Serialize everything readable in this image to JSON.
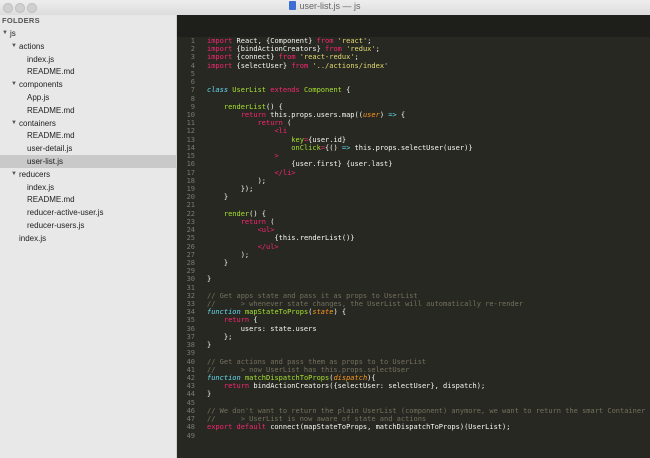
{
  "window": {
    "title": "user-list.js — js"
  },
  "sidebar": {
    "header": "FOLDERS",
    "items": [
      {
        "label": "js",
        "depth": 0,
        "type": "folder"
      },
      {
        "label": "actions",
        "depth": 1,
        "type": "folder"
      },
      {
        "label": "index.js",
        "depth": 2,
        "type": "file"
      },
      {
        "label": "README.md",
        "depth": 2,
        "type": "file"
      },
      {
        "label": "components",
        "depth": 1,
        "type": "folder"
      },
      {
        "label": "App.js",
        "depth": 2,
        "type": "file"
      },
      {
        "label": "README.md",
        "depth": 2,
        "type": "file"
      },
      {
        "label": "containers",
        "depth": 1,
        "type": "folder"
      },
      {
        "label": "README.md",
        "depth": 2,
        "type": "file"
      },
      {
        "label": "user-detail.js",
        "depth": 2,
        "type": "file"
      },
      {
        "label": "user-list.js",
        "depth": 2,
        "type": "file",
        "selected": true
      },
      {
        "label": "reducers",
        "depth": 1,
        "type": "folder"
      },
      {
        "label": "index.js",
        "depth": 2,
        "type": "file"
      },
      {
        "label": "README.md",
        "depth": 2,
        "type": "file"
      },
      {
        "label": "reducer-active-user.js",
        "depth": 2,
        "type": "file"
      },
      {
        "label": "reducer-users.js",
        "depth": 2,
        "type": "file"
      },
      {
        "label": "index.js",
        "depth": 1,
        "type": "file"
      }
    ]
  },
  "editor": {
    "lines": [
      [
        [
          "k",
          "import "
        ],
        [
          "",
          "React, {Component} "
        ],
        [
          "k",
          "from "
        ],
        [
          "s",
          "'react'"
        ],
        [
          "",
          ";"
        ]
      ],
      [
        [
          "k",
          "import "
        ],
        [
          "",
          "{bindActionCreators} "
        ],
        [
          "k",
          "from "
        ],
        [
          "s",
          "'redux'"
        ],
        [
          "",
          ";"
        ]
      ],
      [
        [
          "k",
          "import "
        ],
        [
          "",
          "{connect} "
        ],
        [
          "k",
          "from "
        ],
        [
          "s",
          "'react-redux'"
        ],
        [
          "",
          ";"
        ]
      ],
      [
        [
          "k",
          "import "
        ],
        [
          "",
          "{selectUser} "
        ],
        [
          "k",
          "from "
        ],
        [
          "s",
          "'../actions/index'"
        ]
      ],
      [],
      [],
      [
        [
          "t",
          "class "
        ],
        [
          "f",
          "UserList "
        ],
        [
          "k",
          "extends "
        ],
        [
          "f",
          "Component "
        ],
        [
          "",
          "{"
        ]
      ],
      [],
      [
        [
          "",
          "    "
        ],
        [
          "f",
          "renderList"
        ],
        [
          "",
          "() {"
        ]
      ],
      [
        [
          "",
          "        "
        ],
        [
          "k",
          "return "
        ],
        [
          "",
          "this.props.users.map(("
        ],
        [
          "p",
          "user"
        ],
        [
          "",
          ") "
        ],
        [
          "t",
          "=>"
        ],
        [
          "",
          " {"
        ]
      ],
      [
        [
          "",
          "            "
        ],
        [
          "k",
          "return "
        ],
        [
          "",
          "("
        ]
      ],
      [
        [
          "",
          "                "
        ],
        [
          "k",
          "<"
        ],
        [
          "k",
          "li"
        ]
      ],
      [
        [
          "",
          "                    "
        ],
        [
          "a",
          "key"
        ],
        [
          "k",
          "="
        ],
        [
          "",
          "{user.id}"
        ]
      ],
      [
        [
          "",
          "                    "
        ],
        [
          "a",
          "onClick"
        ],
        [
          "k",
          "="
        ],
        [
          "",
          "{() "
        ],
        [
          "t",
          "=>"
        ],
        [
          "",
          " this.props.selectUser(user)}"
        ]
      ],
      [
        [
          "",
          "                "
        ],
        [
          "k",
          ">"
        ]
      ],
      [
        [
          "",
          "                    "
        ],
        [
          "",
          "{user.first} {user.last}"
        ]
      ],
      [
        [
          "",
          "                "
        ],
        [
          "k",
          "</li>"
        ]
      ],
      [
        [
          "",
          "            );"
        ]
      ],
      [
        [
          "",
          "        });"
        ]
      ],
      [
        [
          "",
          "    }"
        ]
      ],
      [],
      [
        [
          "",
          "    "
        ],
        [
          "f",
          "render"
        ],
        [
          "",
          "() {"
        ]
      ],
      [
        [
          "",
          "        "
        ],
        [
          "k",
          "return "
        ],
        [
          "",
          "("
        ]
      ],
      [
        [
          "",
          "            "
        ],
        [
          "k",
          "<ul>"
        ]
      ],
      [
        [
          "",
          "                "
        ],
        [
          "",
          "{this.renderList()}"
        ]
      ],
      [
        [
          "",
          "            "
        ],
        [
          "k",
          "</ul>"
        ]
      ],
      [
        [
          "",
          "        );"
        ]
      ],
      [
        [
          "",
          "    }"
        ]
      ],
      [],
      [
        [
          "",
          "}"
        ]
      ],
      [],
      [
        [
          "c",
          "// Get apps state and pass it as props to UserList"
        ]
      ],
      [
        [
          "c",
          "//      > whenever state changes, the UserList will automatically re-render"
        ]
      ],
      [
        [
          "t",
          "function "
        ],
        [
          "f",
          "mapStateToProps"
        ],
        [
          "",
          "("
        ],
        [
          "p",
          "state"
        ],
        [
          "",
          ") {"
        ]
      ],
      [
        [
          "",
          "    "
        ],
        [
          "k",
          "return "
        ],
        [
          "",
          "{"
        ]
      ],
      [
        [
          "",
          "        users: state.users"
        ]
      ],
      [
        [
          "",
          "    };"
        ]
      ],
      [
        [
          "",
          "}"
        ]
      ],
      [],
      [
        [
          "c",
          "// Get actions and pass them as props to to UserList"
        ]
      ],
      [
        [
          "c",
          "//      > now UserList has this.props.selectUser"
        ]
      ],
      [
        [
          "t",
          "function "
        ],
        [
          "f",
          "matchDispatchToProps"
        ],
        [
          "",
          "("
        ],
        [
          "p",
          "dispatch"
        ],
        [
          "",
          "){"
        ]
      ],
      [
        [
          "",
          "    "
        ],
        [
          "k",
          "return "
        ],
        [
          "",
          "bindActionCreators({selectUser: selectUser}, dispatch);"
        ]
      ],
      [
        [
          "",
          "}"
        ]
      ],
      [],
      [
        [
          "c",
          "// We don't want to return the plain UserList (component) anymore, we want to return the smart Container"
        ]
      ],
      [
        [
          "c",
          "//      > UserList is now aware of state and actions"
        ]
      ],
      [
        [
          "k",
          "export default "
        ],
        [
          "",
          "connect(mapStateToProps, matchDispatchToProps)(UserList);"
        ]
      ],
      []
    ]
  }
}
